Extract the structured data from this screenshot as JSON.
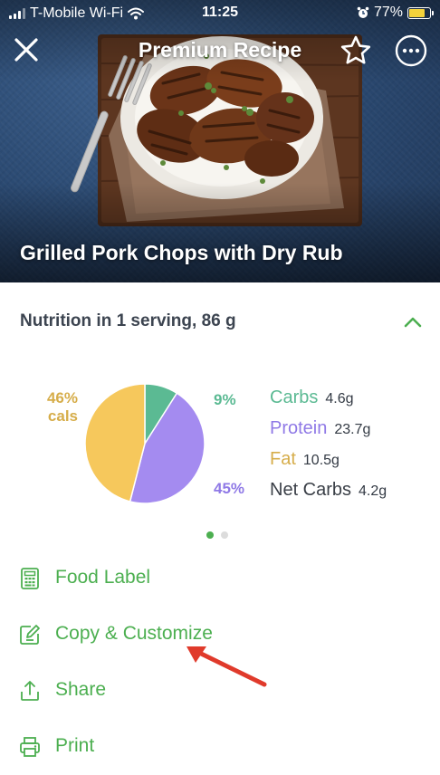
{
  "status_bar": {
    "carrier": "T-Mobile Wi-Fi",
    "time": "11:25",
    "battery_percent": "77%",
    "battery_level": 0.77
  },
  "nav": {
    "title": "Premium Recipe",
    "icons": [
      "close-icon",
      "star-icon",
      "more-icon"
    ]
  },
  "recipe": {
    "title": "Grilled Pork Chops with Dry Rub"
  },
  "nutrition": {
    "header": "Nutrition in 1 serving, 86 g",
    "header_icon": "chevron-up-icon",
    "page_index": 0,
    "page_count": 2
  },
  "chart_data": {
    "type": "pie",
    "values": [
      9,
      45,
      46
    ],
    "categories": [
      "Carbs",
      "Protein",
      "Fat"
    ],
    "colors": [
      "#5bba93",
      "#a48bf0",
      "#f6c85c"
    ],
    "labels": {
      "carbs_pct": "9%",
      "protein_pct": "45%",
      "fat_pct": "46%",
      "fat_unit": "cals"
    }
  },
  "macros": {
    "carbs": {
      "name": "Carbs",
      "value": "4.6g"
    },
    "protein": {
      "name": "Protein",
      "value": "23.7g"
    },
    "fat": {
      "name": "Fat",
      "value": "10.5g"
    },
    "net_carbs": {
      "name": "Net Carbs",
      "value": "4.2g"
    }
  },
  "actions": [
    {
      "label": "Food Label",
      "icon": "calculator-icon"
    },
    {
      "label": "Copy & Customize",
      "icon": "edit-icon"
    },
    {
      "label": "Share",
      "icon": "share-icon"
    },
    {
      "label": "Print",
      "icon": "printer-icon"
    }
  ],
  "colors": {
    "accent": "#4caf50",
    "annotation_arrow": "#e03a2b"
  }
}
